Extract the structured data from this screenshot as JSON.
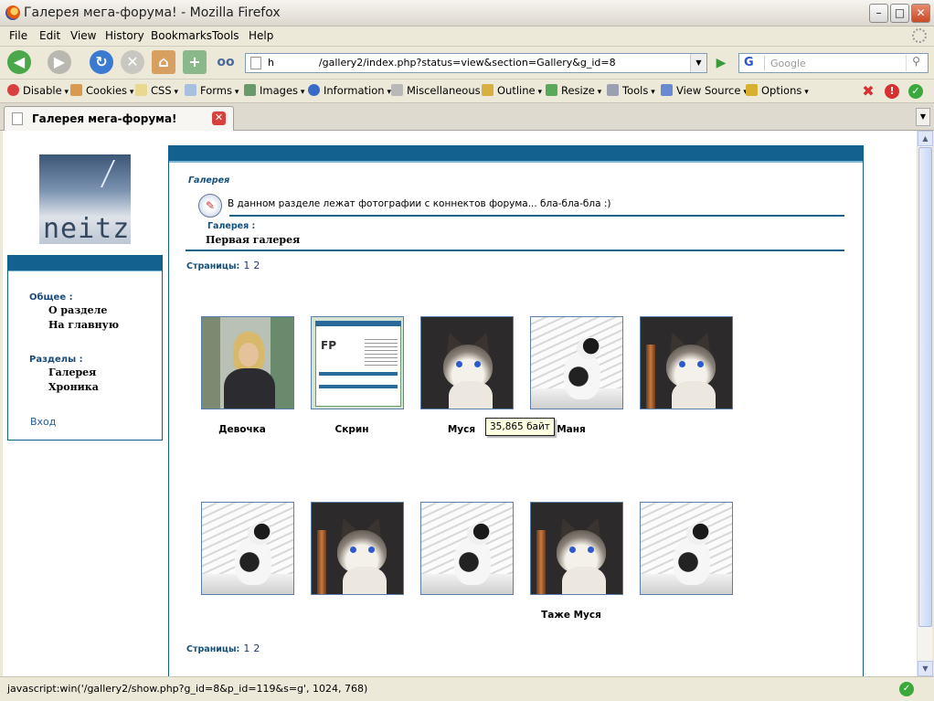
{
  "window": {
    "title": "Галерея мега-форума! - Mozilla Firefox"
  },
  "menubar": {
    "items": [
      "File",
      "Edit",
      "View",
      "History",
      "Bookmarks",
      "Tools",
      "Help"
    ]
  },
  "navbar": {
    "url": "h              /gallery2/index.php?status=view&section=Gallery&g_id=8",
    "search_placeholder": "Google",
    "search_engine_letter": "G"
  },
  "devbar": {
    "items": [
      "Disable",
      "Cookies",
      "CSS",
      "Forms",
      "Images",
      "Information",
      "Miscellaneous",
      "Outline",
      "Resize",
      "Tools",
      "View Source",
      "Options"
    ]
  },
  "tab": {
    "label": "Галерея мега-форума!"
  },
  "sidebar": {
    "logo_text": "neitz",
    "general_label": "Общее :",
    "general_links": [
      "О разделе",
      "На главную"
    ],
    "sections_label": "Разделы :",
    "section_links": [
      "Галерея",
      "Хроника"
    ],
    "login": "Вход"
  },
  "main": {
    "breadcrumb": "Галерея",
    "description": "В данном разделе лежат фотографии с коннектов форума... бла-бла-бла :)",
    "gallery_label": "Галерея :",
    "gallery_name": "Первая галерея",
    "pages_label": "Страницы:",
    "pages": [
      "1",
      "2"
    ],
    "row1_captions": [
      "Девочка",
      "Скрин",
      "Муся",
      "",
      "Маня"
    ],
    "row2_captions": [
      "",
      "",
      "",
      "Таже Муся",
      ""
    ],
    "tooltip": "35,865 байт"
  },
  "statusbar": {
    "text": "javascript:win('/gallery2/show.php?g_id=8&p_id=119&s=g', 1024, 768)"
  },
  "colors": {
    "accent": "#12618e",
    "link": "#14507a"
  }
}
